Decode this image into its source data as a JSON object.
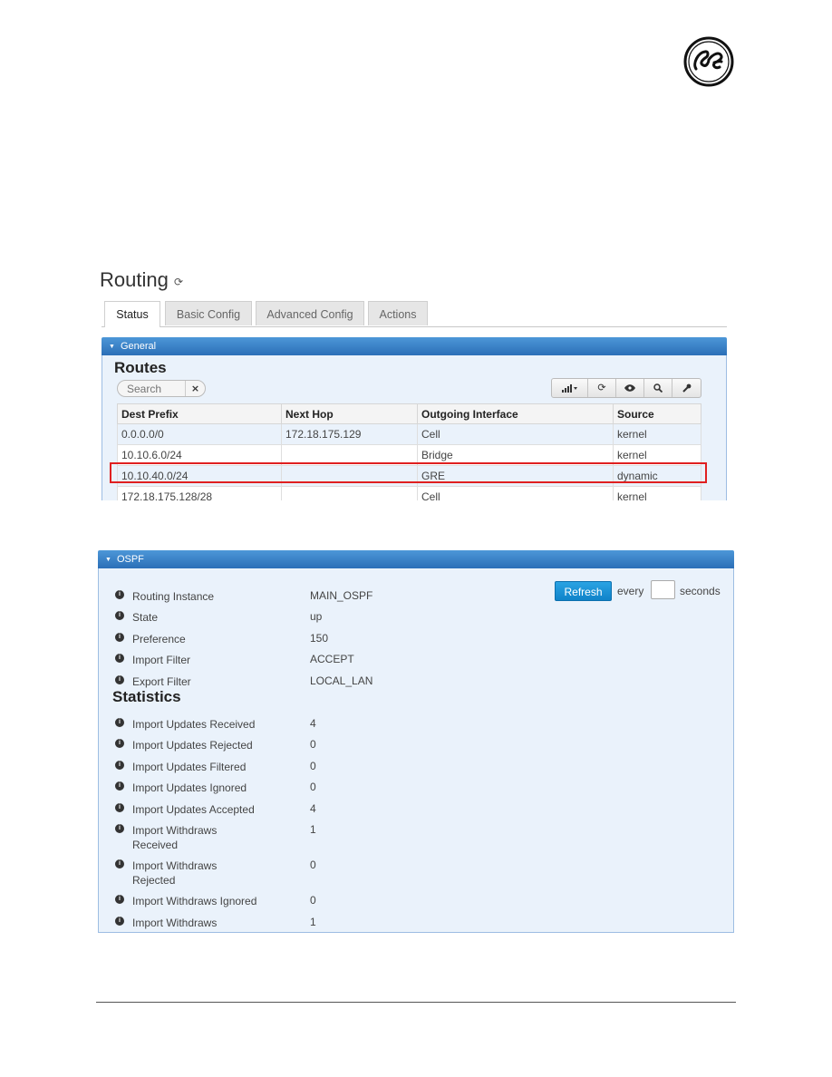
{
  "routing": {
    "page_title": "Routing",
    "refresh_icon": "refresh-icon",
    "tabs": [
      "Status",
      "Basic Config",
      "Advanced Config",
      "Actions"
    ],
    "active_tab": "Status",
    "general_panel": {
      "title": "General",
      "routes_heading": "Routes",
      "search_placeholder": "Search",
      "search_clear": "×",
      "toolbar_icons": [
        "signal-dropdown-icon",
        "refresh-icon",
        "eye-icon",
        "search-icon",
        "wrench-icon"
      ],
      "columns": [
        "Dest Prefix",
        "Next Hop",
        "Outgoing Interface",
        "Source"
      ],
      "rows": [
        [
          "0.0.0.0/0",
          "172.18.175.129",
          "Cell",
          "kernel"
        ],
        [
          "10.10.6.0/24",
          "",
          "Bridge",
          "kernel"
        ],
        [
          "10.10.40.0/24",
          "",
          "GRE",
          "dynamic"
        ],
        [
          "172.18.175.128/28",
          "",
          "Cell",
          "kernel"
        ]
      ]
    }
  },
  "ospf": {
    "panel_title": "OSPF",
    "refresh_label": "Refresh",
    "every_label": "every",
    "seconds_label": "seconds",
    "every_value": "",
    "info": [
      {
        "label": "Routing Instance",
        "value": "MAIN_OSPF"
      },
      {
        "label": "State",
        "value": "up"
      },
      {
        "label": "Preference",
        "value": "150"
      },
      {
        "label": "Import Filter",
        "value": "ACCEPT"
      },
      {
        "label": "Export Filter",
        "value": "LOCAL_LAN"
      }
    ],
    "statistics_heading": "Statistics",
    "statistics": [
      {
        "label": "Import Updates Received",
        "value": "4"
      },
      {
        "label": "Import Updates Rejected",
        "value": "0"
      },
      {
        "label": "Import Updates Filtered",
        "value": "0"
      },
      {
        "label": "Import Updates Ignored",
        "value": "0"
      },
      {
        "label": "Import Updates Accepted",
        "value": "4"
      },
      {
        "label": "Import Withdraws Received",
        "value": "1"
      },
      {
        "label": "Import Withdraws Rejected",
        "value": "0"
      },
      {
        "label": "Import Withdraws Ignored",
        "value": "0"
      },
      {
        "label": "Import Withdraws Accepted",
        "value": "1"
      }
    ]
  },
  "colors": {
    "panel_header": "#2b6fb7",
    "panel_body": "#eaf2fb",
    "refresh_button": "#1a93d6",
    "highlight_box": "#e02020"
  }
}
